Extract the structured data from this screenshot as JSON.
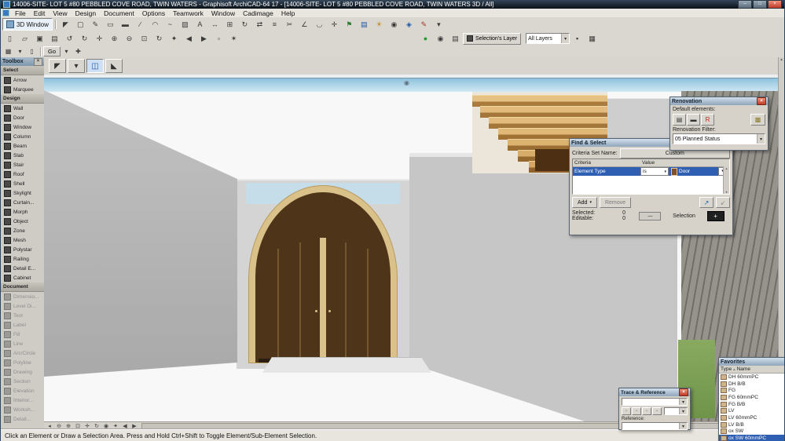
{
  "ui": {
    "close_glyph": "×",
    "dropdown_arrow": "▾",
    "up_arrow": "▴",
    "down_arrow": "▾",
    "left_arrow": "◂",
    "right_arrow": "▸",
    "minus_glyph": "—",
    "plus_glyph": "+",
    "sort_asc_glyph": "▵"
  },
  "window": {
    "title": "14006-SITE- LOT 5 #80 PEBBLED COVE ROAD, TWIN WATERS - Graphisoft ArchiCAD-64 17 - [14006-SITE- LOT 5 #80 PEBBLED COVE ROAD, TWIN WATERS 3D / All]",
    "minimize_glyph": "–",
    "maximize_glyph": "□",
    "close_glyph": "×"
  },
  "menu": {
    "items": [
      "File",
      "Edit",
      "View",
      "Design",
      "Document",
      "Options",
      "Teamwork",
      "Window",
      "Cadimage",
      "Help"
    ]
  },
  "toolbar1": {
    "view_button_label": "3D Window",
    "icons": [
      {
        "n": "arrow-cursor",
        "g": "◤"
      },
      {
        "n": "marquee",
        "g": "▢"
      },
      {
        "n": "pencil",
        "g": "✎"
      },
      {
        "n": "eraser",
        "g": "▭"
      },
      {
        "n": "wall-tool",
        "g": "▬"
      },
      {
        "n": "line-tool",
        "g": "∕"
      },
      {
        "n": "arc-tool",
        "g": "◠"
      },
      {
        "n": "polyline-tool",
        "g": "~"
      },
      {
        "n": "fill-tool",
        "g": "▨"
      },
      {
        "n": "text-tool",
        "g": "A"
      },
      {
        "n": "dimension-tool",
        "g": "↔"
      },
      {
        "n": "grid-tool",
        "g": "⊞"
      },
      {
        "n": "rotate",
        "g": "↻"
      },
      {
        "n": "mirror",
        "g": "⇄"
      },
      {
        "n": "align",
        "g": "≡"
      },
      {
        "n": "trim",
        "g": "✂"
      },
      {
        "n": "split",
        "g": "∠"
      },
      {
        "n": "fillet",
        "g": "◡"
      },
      {
        "n": "move",
        "g": "✛"
      },
      {
        "n": "flag",
        "g": "⚑",
        "c": "#2e7d32"
      },
      {
        "n": "layers",
        "g": "▤",
        "c": "#1a57a8"
      },
      {
        "n": "sun-study",
        "g": "☀",
        "c": "#c08a1a"
      },
      {
        "n": "camera",
        "g": "◉"
      },
      {
        "n": "marker",
        "g": "◈",
        "c": "#1a57a8"
      },
      {
        "n": "annotate",
        "g": "✎",
        "c": "#a33327"
      },
      {
        "n": "more-tools",
        "g": "▾"
      }
    ]
  },
  "toolbar2": {
    "icons_left": [
      {
        "n": "new-file",
        "g": "▯"
      },
      {
        "n": "open-file",
        "g": "▱"
      },
      {
        "n": "save-file",
        "g": "▣"
      },
      {
        "n": "print",
        "g": "▤"
      },
      {
        "n": "undo",
        "g": "↺"
      },
      {
        "n": "redo",
        "g": "↻"
      },
      {
        "n": "pan",
        "g": "✛"
      },
      {
        "n": "zoom-in",
        "g": "⊕"
      },
      {
        "n": "zoom-out",
        "g": "⊖"
      },
      {
        "n": "fit-in-window",
        "g": "⊡"
      },
      {
        "n": "orbit",
        "g": "↻"
      },
      {
        "n": "explore",
        "g": "✦"
      },
      {
        "n": "previous-view",
        "g": "◀"
      },
      {
        "n": "next-view",
        "g": "▶"
      },
      {
        "n": "selection-marquee",
        "g": "▫"
      },
      {
        "n": "find-select",
        "g": "✶"
      }
    ],
    "render_buttons": [
      {
        "n": "quick-render",
        "g": "●",
        "c": "#1f9d2c"
      }
    ],
    "icons_mid": [
      {
        "n": "show-selection",
        "g": "◉"
      },
      {
        "n": "quick-layers",
        "g": "▤"
      }
    ],
    "selections_layer_label": "Selection's Layer",
    "all_layers_value": "All Layers",
    "icons_right": [
      {
        "n": "layer-lock",
        "g": "▪"
      },
      {
        "n": "layer-settings",
        "g": "▦"
      }
    ]
  },
  "toolbar3": {
    "icons_left": [
      {
        "n": "project-chooser",
        "g": "▦"
      },
      {
        "n": "project-dropdown",
        "g": "▾"
      },
      {
        "n": "document-view",
        "g": "▯"
      }
    ],
    "go_label": "Go",
    "icons_right": [
      {
        "n": "go-dropdown",
        "g": "▾"
      },
      {
        "n": "walk-mode",
        "g": "✚"
      }
    ]
  },
  "infobar": {
    "icons": [
      {
        "n": "arrow-tool",
        "g": "◤"
      },
      {
        "n": "selection-options",
        "g": "▾"
      },
      {
        "n": "active-door-tool",
        "g": "◫",
        "c": "#1a57a8",
        "p": 1
      },
      {
        "n": "sub-element",
        "g": "◣"
      }
    ]
  },
  "toolbox": {
    "title": "Toolbox",
    "select_header": "Select",
    "select_items": [
      "Arrow",
      "Marquee"
    ],
    "design_header": "Design",
    "design_items": [
      "Wall",
      "Door",
      "Window",
      "Column",
      "Beam",
      "Slab",
      "Stair",
      "Roof",
      "Shell",
      "Skylight",
      "Curtain...",
      "Morph",
      "Object",
      "Zone",
      "Mesh",
      "Polystar",
      "Railing",
      "Detail E...",
      "Cabinet"
    ],
    "document_header": "Document",
    "document_items": [
      "Dimensio...",
      "Level Di...",
      "Text",
      "Label",
      "Fill",
      "Line",
      "Arc/Circle",
      "Polyline",
      "Drawing",
      "Section",
      "Elevation",
      "Interior...",
      "Worksh...",
      "Detail..."
    ]
  },
  "viewport": {
    "camera_marker": "◉"
  },
  "palettes": {
    "renovation": {
      "title": "Renovation",
      "default_elements_label": "Default elements:",
      "default_buttons": [
        {
          "n": "existing-elements",
          "g": "▤"
        },
        {
          "n": "new-elements",
          "g": "▬"
        },
        {
          "n": "demolished-elements",
          "g": "R",
          "c": "#b03020"
        }
      ],
      "options_buttons": [
        {
          "n": "renovation-options",
          "g": "▩",
          "c": "#8a7a2a"
        }
      ],
      "filter_label": "Renovation Filter:",
      "filter_value": "05 Planned Status"
    },
    "find_select": {
      "title": "Find & Select",
      "criteria_set_label": "Criteria Set Name:",
      "criteria_set_value": "Custom",
      "criteria_header": "Criteria",
      "value_header": "Value",
      "row": {
        "criteria": "Element Type",
        "operator": "is",
        "value": "Door"
      },
      "add_button": "Add",
      "remove_button": "Remove",
      "selected_label": "Selected:",
      "selected_value": "0",
      "editable_label": "Editable:",
      "editable_value": "0",
      "selection_label": "Selection",
      "pick_icons": [
        {
          "n": "pick-up-criteria",
          "g": "↗",
          "c": "#1a57a8"
        },
        {
          "n": "apply-criteria",
          "g": "↙",
          "c": "#8a8a8a"
        }
      ]
    },
    "trace_reference": {
      "title": "Trace & Reference",
      "reference_label": "Reference:",
      "buttons": [
        {
          "n": "trace-switch",
          "g": "▫"
        },
        {
          "n": "trace-rotate",
          "g": "▫"
        },
        {
          "n": "trace-move",
          "g": "▫"
        },
        {
          "n": "trace-more",
          "g": "▫"
        }
      ]
    },
    "favorites": {
      "title": "Favorites",
      "type_header": "Type",
      "name_header": "Name",
      "items": [
        "DH 60mmPC",
        "DH B/B",
        "FG",
        "FG 60mmPC",
        "FG B/B",
        "LV",
        "LV 60mmPC",
        "LV B/B",
        "ox SW",
        "ox SW 60mmPC"
      ],
      "selected_index": 9
    }
  },
  "bottombar": {
    "icons": [
      {
        "n": "scroll-left",
        "g": "◂"
      },
      {
        "n": "zoom-out",
        "g": "⊖"
      },
      {
        "n": "zoom-in",
        "g": "⊕"
      },
      {
        "n": "fit-in-window",
        "g": "⊡"
      },
      {
        "n": "pan",
        "g": "✛"
      },
      {
        "n": "orbit",
        "g": "↻"
      },
      {
        "n": "look-to",
        "g": "◉"
      },
      {
        "n": "explore",
        "g": "✦"
      },
      {
        "n": "previous-view",
        "g": "◀"
      },
      {
        "n": "next-view",
        "g": "▶"
      }
    ]
  },
  "statusbar": {
    "text": "Click an Element or Draw a Selection Area. Press and Hold Ctrl+Shift to Toggle Element/Sub-Element Selection."
  }
}
